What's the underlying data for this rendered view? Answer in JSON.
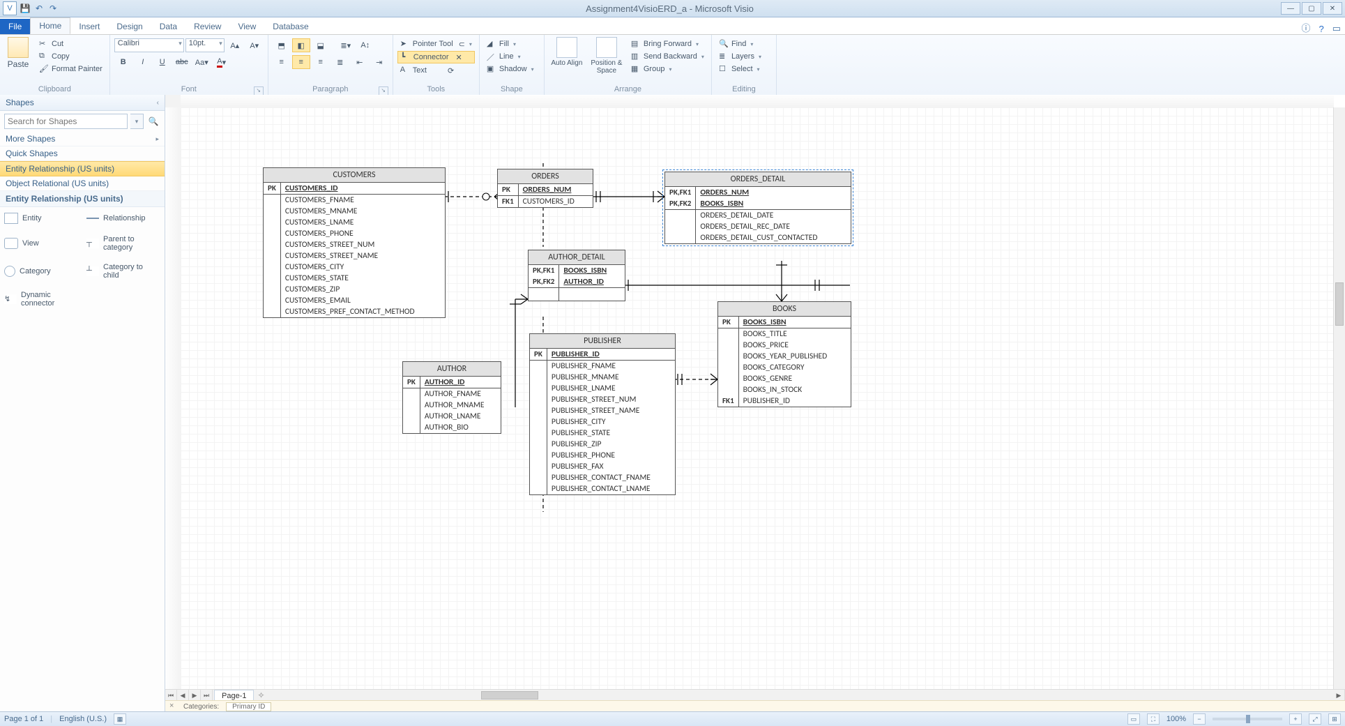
{
  "titlebar": {
    "doc_title": "Assignment4VisioERD_a  -  Microsoft Visio"
  },
  "tabs": {
    "file": "File",
    "home": "Home",
    "insert": "Insert",
    "design": "Design",
    "data": "Data",
    "review": "Review",
    "view": "View",
    "database": "Database"
  },
  "ribbon": {
    "clipboard": {
      "paste": "Paste",
      "cut": "Cut",
      "copy": "Copy",
      "format_painter": "Format Painter",
      "label": "Clipboard"
    },
    "font": {
      "name": "Calibri",
      "size": "10pt.",
      "label": "Font"
    },
    "paragraph": {
      "label": "Paragraph"
    },
    "tools": {
      "pointer": "Pointer Tool",
      "connector": "Connector",
      "text": "Text",
      "label": "Tools"
    },
    "shape": {
      "fill": "Fill",
      "line": "Line",
      "shadow": "Shadow",
      "label": "Shape"
    },
    "arrange": {
      "autoalign": "Auto Align",
      "position": "Position & Space",
      "bring_forward": "Bring Forward",
      "send_backward": "Send Backward",
      "group": "Group",
      "label": "Arrange"
    },
    "editing": {
      "find": "Find",
      "layers": "Layers",
      "select": "Select",
      "label": "Editing"
    }
  },
  "shapespane": {
    "title": "Shapes",
    "search_placeholder": "Search for Shapes",
    "more_shapes": "More Shapes",
    "quick_shapes": "Quick Shapes",
    "er_us": "Entity Relationship (US units)",
    "or_us": "Object Relational (US units)",
    "stencil_hdr": "Entity Relationship (US units)",
    "items": {
      "entity": "Entity",
      "relationship": "Relationship",
      "view": "View",
      "parent_to_category": "Parent to category",
      "category": "Category",
      "category_to_child": "Category to child",
      "dynamic_connector": "Dynamic connector"
    }
  },
  "pages": {
    "page1": "Page-1"
  },
  "categories": {
    "label": "Categories:",
    "item": "Primary ID"
  },
  "statusbar": {
    "page": "Page 1 of 1",
    "lang": "English (U.S.)",
    "zoom": "100%"
  },
  "entities": {
    "customers": {
      "title": "CUSTOMERS",
      "pk": "CUSTOMERS_ID",
      "attrs": [
        "CUSTOMERS_FNAME",
        "CUSTOMERS_MNAME",
        "CUSTOMERS_LNAME",
        "CUSTOMERS_PHONE",
        "CUSTOMERS_STREET_NUM",
        "CUSTOMERS_STREET_NAME",
        "CUSTOMERS_CITY",
        "CUSTOMERS_STATE",
        "CUSTOMERS_ZIP",
        "CUSTOMERS_EMAIL",
        "CUSTOMERS_PREF_CONTACT_METHOD"
      ]
    },
    "orders": {
      "title": "ORDERS",
      "pk": "ORDERS_NUM",
      "fk1_label": "FK1",
      "fk1": "CUSTOMERS_ID"
    },
    "orders_detail": {
      "title": "ORDERS_DETAIL",
      "pk1_label": "PK,FK1",
      "pk1": "ORDERS_NUM",
      "pk2_label": "PK,FK2",
      "pk2": "BOOKS_ISBN",
      "attrs": [
        "ORDERS_DETAIL_DATE",
        "ORDERS_DETAIL_REC_DATE",
        "ORDERS_DETAIL_CUST_CONTACTED"
      ]
    },
    "author_detail": {
      "title": "AUTHOR_DETAIL",
      "pk1_label": "PK,FK1",
      "pk1": "BOOKS_ISBN",
      "pk2_label": "PK,FK2",
      "pk2": "AUTHOR_ID"
    },
    "author": {
      "title": "AUTHOR",
      "pk": "AUTHOR_ID",
      "attrs": [
        "AUTHOR_FNAME",
        "AUTHOR_MNAME",
        "AUTHOR_LNAME",
        "AUTHOR_BIO"
      ]
    },
    "publisher": {
      "title": "PUBLISHER",
      "pk": "PUBLISHER_ID",
      "attrs": [
        "PUBLISHER_FNAME",
        "PUBLISHER_MNAME",
        "PUBLISHER_LNAME",
        "PUBLISHER_STREET_NUM",
        "PUBLISHER_STREET_NAME",
        "PUBLISHER_CITY",
        "PUBLISHER_STATE",
        "PUBLISHER_ZIP",
        "PUBLISHER_PHONE",
        "PUBLISHER_FAX",
        "PUBLISHER_CONTACT_FNAME",
        "PUBLISHER_CONTACT_LNAME"
      ]
    },
    "books": {
      "title": "BOOKS",
      "pk": "BOOKS_ISBN",
      "attrs": [
        "BOOKS_TITLE",
        "BOOKS_PRICE",
        "BOOKS_YEAR_PUBLISHED",
        "BOOKS_CATEGORY",
        "BOOKS_GENRE",
        "BOOKS_IN_STOCK"
      ],
      "fk1_label": "FK1",
      "fk1": "PUBLISHER_ID"
    }
  },
  "pk_label": "PK"
}
